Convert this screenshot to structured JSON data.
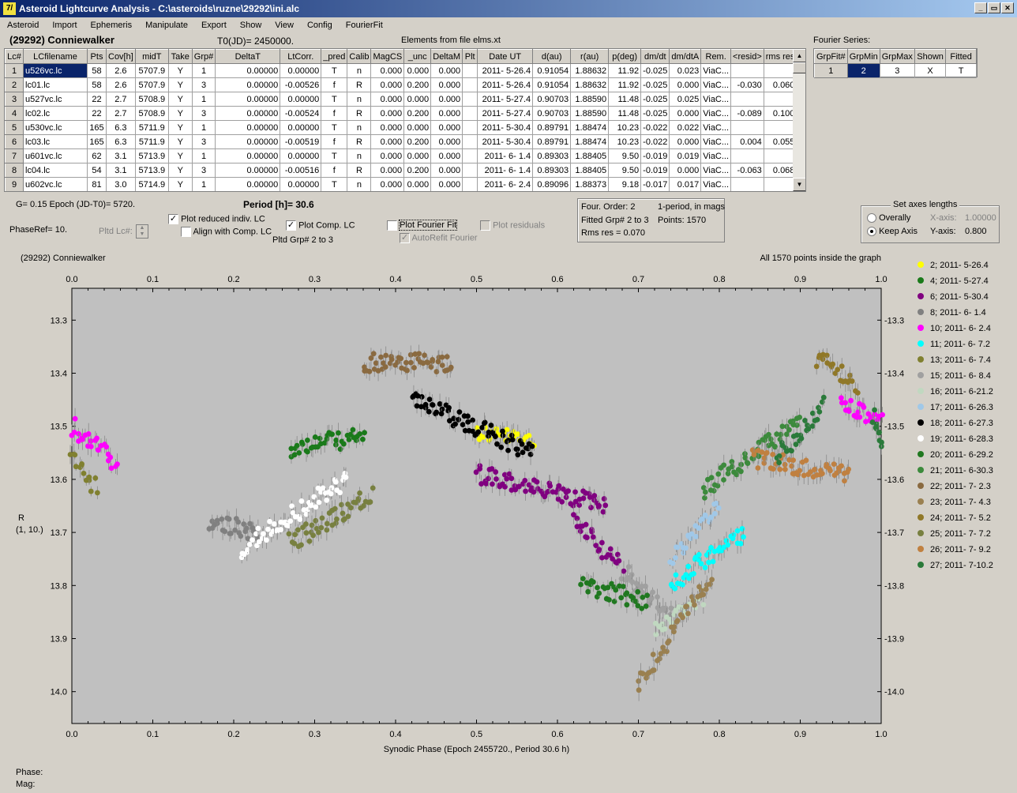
{
  "window": {
    "title": "Asteroid Lightcurve Analysis - C:\\asteroids\\ruzne\\29292\\ini.alc",
    "icon_text": "7/"
  },
  "menu": [
    "Asteroid",
    "Import",
    "Ephemeris",
    "Manipulate",
    "Export",
    "Show",
    "View",
    "Config",
    "FourierFit"
  ],
  "header": {
    "asteroid_name": "(29292) Conniewalker",
    "t0": "T0(JD)= 2450000.",
    "elements_note": "Elements from file elms.xt",
    "fourier_label": "Fourier Series:"
  },
  "lc_table": {
    "columns": [
      "Lc#",
      "LCfilename",
      "Pts",
      "Cov[h]",
      "midT",
      "Take",
      "Grp#",
      "DeltaT",
      "LtCorr.",
      "_pred",
      "Calib",
      "MagCS",
      "_unc",
      "DeltaM",
      "Plt",
      "Date UT",
      "d(au)",
      "r(au)",
      "p(deg)",
      "dm/dt",
      "dm/dtA",
      "Rem.",
      "<resid>",
      "rms res"
    ],
    "rows": [
      [
        "1",
        "u526vc.lc",
        "58",
        "2.6",
        "5707.9",
        "Y",
        "1",
        "0.00000",
        "0.00000",
        "T",
        "n",
        "0.000",
        "0.000",
        "0.000",
        "",
        "2011- 5-26.4",
        "0.91054",
        "1.88632",
        "11.92",
        "-0.025",
        "0.023",
        "ViaC...",
        "",
        ""
      ],
      [
        "2",
        "lc01.lc",
        "58",
        "2.6",
        "5707.9",
        "Y",
        "3",
        "0.00000",
        "-0.00526",
        "f",
        "R",
        "0.000",
        "0.200",
        "0.000",
        "",
        "2011- 5-26.4",
        "0.91054",
        "1.88632",
        "11.92",
        "-0.025",
        "0.000",
        "ViaC...",
        "-0.030",
        "0.060"
      ],
      [
        "3",
        "u527vc.lc",
        "22",
        "2.7",
        "5708.9",
        "Y",
        "1",
        "0.00000",
        "0.00000",
        "T",
        "n",
        "0.000",
        "0.000",
        "0.000",
        "",
        "2011- 5-27.4",
        "0.90703",
        "1.88590",
        "11.48",
        "-0.025",
        "0.025",
        "ViaC...",
        "",
        ""
      ],
      [
        "4",
        "lc02.lc",
        "22",
        "2.7",
        "5708.9",
        "Y",
        "3",
        "0.00000",
        "-0.00524",
        "f",
        "R",
        "0.000",
        "0.200",
        "0.000",
        "",
        "2011- 5-27.4",
        "0.90703",
        "1.88590",
        "11.48",
        "-0.025",
        "0.000",
        "ViaC...",
        "-0.089",
        "0.100"
      ],
      [
        "5",
        "u530vc.lc",
        "165",
        "6.3",
        "5711.9",
        "Y",
        "1",
        "0.00000",
        "0.00000",
        "T",
        "n",
        "0.000",
        "0.000",
        "0.000",
        "",
        "2011- 5-30.4",
        "0.89791",
        "1.88474",
        "10.23",
        "-0.022",
        "0.022",
        "ViaC...",
        "",
        ""
      ],
      [
        "6",
        "lc03.lc",
        "165",
        "6.3",
        "5711.9",
        "Y",
        "3",
        "0.00000",
        "-0.00519",
        "f",
        "R",
        "0.000",
        "0.200",
        "0.000",
        "",
        "2011- 5-30.4",
        "0.89791",
        "1.88474",
        "10.23",
        "-0.022",
        "0.000",
        "ViaC...",
        "0.004",
        "0.055"
      ],
      [
        "7",
        "u601vc.lc",
        "62",
        "3.1",
        "5713.9",
        "Y",
        "1",
        "0.00000",
        "0.00000",
        "T",
        "n",
        "0.000",
        "0.000",
        "0.000",
        "",
        "2011- 6- 1.4",
        "0.89303",
        "1.88405",
        "9.50",
        "-0.019",
        "0.019",
        "ViaC...",
        "",
        ""
      ],
      [
        "8",
        "lc04.lc",
        "54",
        "3.1",
        "5713.9",
        "Y",
        "3",
        "0.00000",
        "-0.00516",
        "f",
        "R",
        "0.000",
        "0.200",
        "0.000",
        "",
        "2011- 6- 1.4",
        "0.89303",
        "1.88405",
        "9.50",
        "-0.019",
        "0.000",
        "ViaC...",
        "-0.063",
        "0.068"
      ],
      [
        "9",
        "u602vc.lc",
        "81",
        "3.0",
        "5714.9",
        "Y",
        "1",
        "0.00000",
        "0.00000",
        "T",
        "n",
        "0.000",
        "0.000",
        "0.000",
        "",
        "2011- 6- 2.4",
        "0.89096",
        "1.88373",
        "9.18",
        "-0.017",
        "0.017",
        "ViaC...",
        "",
        ""
      ]
    ]
  },
  "fourier_table": {
    "columns": [
      "GrpFit#",
      "GrpMin",
      "GrpMax",
      "Shown",
      "Fitted"
    ],
    "row": [
      "1",
      "2",
      "3",
      "X",
      "T"
    ]
  },
  "controls": {
    "g_epoch": "G= 0.15   Epoch (JD-T0)= 5720.",
    "period_label": "Period [h]= 30.6",
    "phaseref": "PhaseRef= 10.",
    "pltd_lc": "Pltd Lc#:",
    "plot_reduced": "Plot reduced indiv. LC",
    "align_comp": "Align with Comp. LC",
    "plot_comp": "Plot Comp. LC",
    "pltd_grp": "Pltd Grp#  2   to   3",
    "plot_fourier": "Plot Fourier Fit",
    "autorefit": "AutoRefit Fourier",
    "plot_residuals": "Plot residuals",
    "info_line1": "Four. Order:  2",
    "info_line1b": "1-period, in mags",
    "info_line2": "Fitted Grp# 2 to 3",
    "info_line2b": "Points: 1570",
    "info_line3": "Rms res      = 0.070",
    "axes_title": "Set axes lengths",
    "overally": "Overally",
    "keep_axis": "Keep Axis",
    "x_axis_label": "X-axis:",
    "x_axis_val": "1.00000",
    "y_axis_label": "Y-axis:",
    "y_axis_val": "0.800"
  },
  "status": {
    "phase": "Phase:",
    "mag": "Mag:"
  },
  "chart_data": {
    "type": "scatter",
    "title": "(29292) Conniewalker",
    "note": "All 1570 points inside the graph",
    "xlabel": "Synodic Phase (Epoch 2455720., Period 30.6 h)",
    "ylabel": "R",
    "ylabel2": "(1, 10.)",
    "xlim": [
      0.0,
      1.0
    ],
    "ylim": [
      14.06,
      13.24
    ],
    "x_ticks": [
      "0.0",
      "0.1",
      "0.2",
      "0.3",
      "0.4",
      "0.5",
      "0.6",
      "0.7",
      "0.8",
      "0.9",
      "1.0"
    ],
    "y_ticks": [
      "13.3",
      "13.4",
      "13.5",
      "13.6",
      "13.7",
      "13.8",
      "13.9",
      "14.0"
    ],
    "y_inverted": true,
    "series": [
      {
        "name": "2; 2011- 5-26.4",
        "color": "#ffff00",
        "segments": [
          [
            0.5,
            0.57,
            13.51,
            13.53
          ]
        ]
      },
      {
        "name": "4; 2011- 5-27.4",
        "color": "#1a7a1a",
        "segments": [
          [
            0.27,
            0.36,
            13.54,
            13.52
          ]
        ]
      },
      {
        "name": "6; 2011- 5-30.4",
        "color": "#800080",
        "segments": [
          [
            0.5,
            0.66,
            13.59,
            13.65
          ],
          [
            0.62,
            0.68,
            13.67,
            13.77
          ]
        ]
      },
      {
        "name": "8; 2011- 6- 1.4",
        "color": "#808080",
        "segments": [
          [
            0.17,
            0.23,
            13.68,
            13.7
          ]
        ]
      },
      {
        "name": "10; 2011- 6- 2.4",
        "color": "#ff00ff",
        "segments": [
          [
            0.0,
            0.055,
            13.5,
            13.57
          ],
          [
            0.95,
            1.0,
            13.46,
            13.49
          ]
        ]
      },
      {
        "name": "11; 2011- 6- 7.2",
        "color": "#00ffff",
        "segments": [
          [
            0.74,
            0.83,
            13.8,
            13.7
          ]
        ]
      },
      {
        "name": "13; 2011- 6- 7.4",
        "color": "#808030",
        "segments": [
          [
            0.0,
            0.03,
            13.55,
            13.62
          ]
        ]
      },
      {
        "name": "15; 2011- 6- 8.4",
        "color": "#a0a0a0",
        "segments": [
          [
            0.68,
            0.74,
            13.77,
            13.86
          ]
        ]
      },
      {
        "name": "16; 2011- 6-21.2",
        "color": "#c0d8c0",
        "segments": [
          [
            0.72,
            0.78,
            13.88,
            13.82
          ]
        ]
      },
      {
        "name": "17; 2011- 6-26.3",
        "color": "#a0c8e8",
        "segments": [
          [
            0.74,
            0.8,
            13.75,
            13.64
          ]
        ]
      },
      {
        "name": "18; 2011- 6-27.3",
        "color": "#000000",
        "segments": [
          [
            0.42,
            0.57,
            13.45,
            13.55
          ]
        ]
      },
      {
        "name": "19; 2011- 6-28.3",
        "color": "#ffffff",
        "segments": [
          [
            0.21,
            0.34,
            13.73,
            13.6
          ]
        ]
      },
      {
        "name": "20; 2011- 6-29.2",
        "color": "#207820",
        "segments": [
          [
            0.63,
            0.71,
            13.8,
            13.83
          ]
        ]
      },
      {
        "name": "21; 2011- 6-30.3",
        "color": "#3c8a3c",
        "segments": [
          [
            0.78,
            0.9,
            13.62,
            13.49
          ]
        ]
      },
      {
        "name": "22; 2011- 7- 2.3",
        "color": "#8a6a40",
        "segments": [
          [
            0.36,
            0.47,
            13.38,
            13.38
          ]
        ]
      },
      {
        "name": "23; 2011- 7- 4.3",
        "color": "#9a8050",
        "segments": [
          [
            0.7,
            0.79,
            13.99,
            13.78
          ]
        ]
      },
      {
        "name": "24; 2011- 7- 5.2",
        "color": "#907828",
        "segments": [
          [
            0.92,
            0.97,
            13.37,
            13.42
          ]
        ]
      },
      {
        "name": "25; 2011- 7- 7.2",
        "color": "#788040",
        "segments": [
          [
            0.27,
            0.37,
            13.72,
            13.63
          ]
        ]
      },
      {
        "name": "26; 2011- 7- 9.2",
        "color": "#c08040",
        "segments": [
          [
            0.84,
            0.96,
            13.56,
            13.59
          ]
        ]
      },
      {
        "name": "27; 2011- 7-10.2",
        "color": "#2a7a3a",
        "segments": [
          [
            0.87,
            0.93,
            13.56,
            13.46
          ],
          [
            0.99,
            1.0,
            13.48,
            13.53
          ]
        ]
      }
    ]
  }
}
